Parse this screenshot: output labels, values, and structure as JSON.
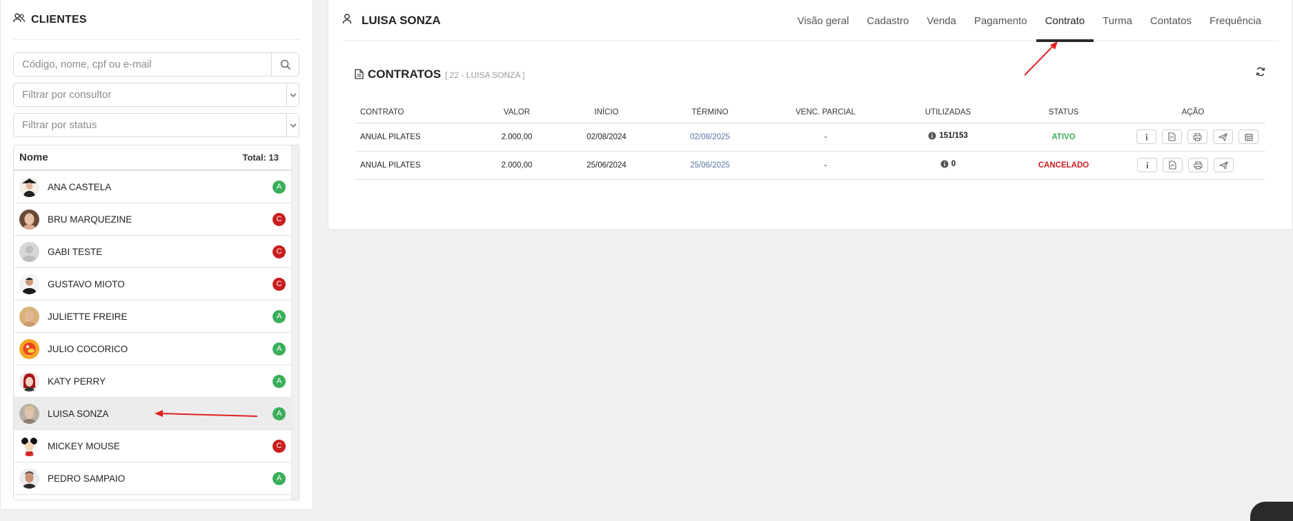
{
  "sidebar": {
    "title": "CLIENTES",
    "search_placeholder": "Código, nome, cpf ou e-mail",
    "filter_consultant": "Filtrar por consultor",
    "filter_status": "Filtrar por status",
    "list_header_name": "Nome",
    "list_total": "Total: 13",
    "clients": [
      {
        "name": "ANA CASTELA",
        "status": "A"
      },
      {
        "name": "BRU MARQUEZINE",
        "status": "C"
      },
      {
        "name": "GABI TESTE",
        "status": "C"
      },
      {
        "name": "GUSTAVO MIOTO",
        "status": "C"
      },
      {
        "name": "JULIETTE FREIRE",
        "status": "A"
      },
      {
        "name": "JULIO COCORICO",
        "status": "A"
      },
      {
        "name": "KATY PERRY",
        "status": "A"
      },
      {
        "name": "LUISA SONZA",
        "status": "A"
      },
      {
        "name": "MICKEY MOUSE",
        "status": "C"
      },
      {
        "name": "PEDRO SAMPAIO",
        "status": "A"
      }
    ]
  },
  "profile": {
    "name": "LUISA SONZA",
    "tabs": [
      "Visão geral",
      "Cadastro",
      "Venda",
      "Pagamento",
      "Contrato",
      "Turma",
      "Contatos",
      "Frequência"
    ],
    "active_tab": "Contrato"
  },
  "contracts": {
    "title": "CONTRATOS",
    "subtitle": "[ 22 - LUISA SONZA ]",
    "columns": [
      "CONTRATO",
      "VALOR",
      "INÍCIO",
      "TÉRMINO",
      "VENC. PARCIAL",
      "UTILIZADAS",
      "STATUS",
      "AÇÃO"
    ],
    "rows": [
      {
        "contract": "ANUAL PILATES",
        "value": "2.000,00",
        "start": "02/08/2024",
        "end": "02/08/2025",
        "partial": "-",
        "used": "151/153",
        "status": "ATIVO"
      },
      {
        "contract": "ANUAL PILATES",
        "value": "2.000,00",
        "start": "25/06/2024",
        "end": "25/06/2025",
        "partial": "-",
        "used": "0",
        "status": "CANCELADO"
      }
    ]
  },
  "colors": {
    "active": "#3bae5a",
    "cancelled": "#c81e1e",
    "link": "#5a74a6",
    "arrow": "#e02020"
  }
}
